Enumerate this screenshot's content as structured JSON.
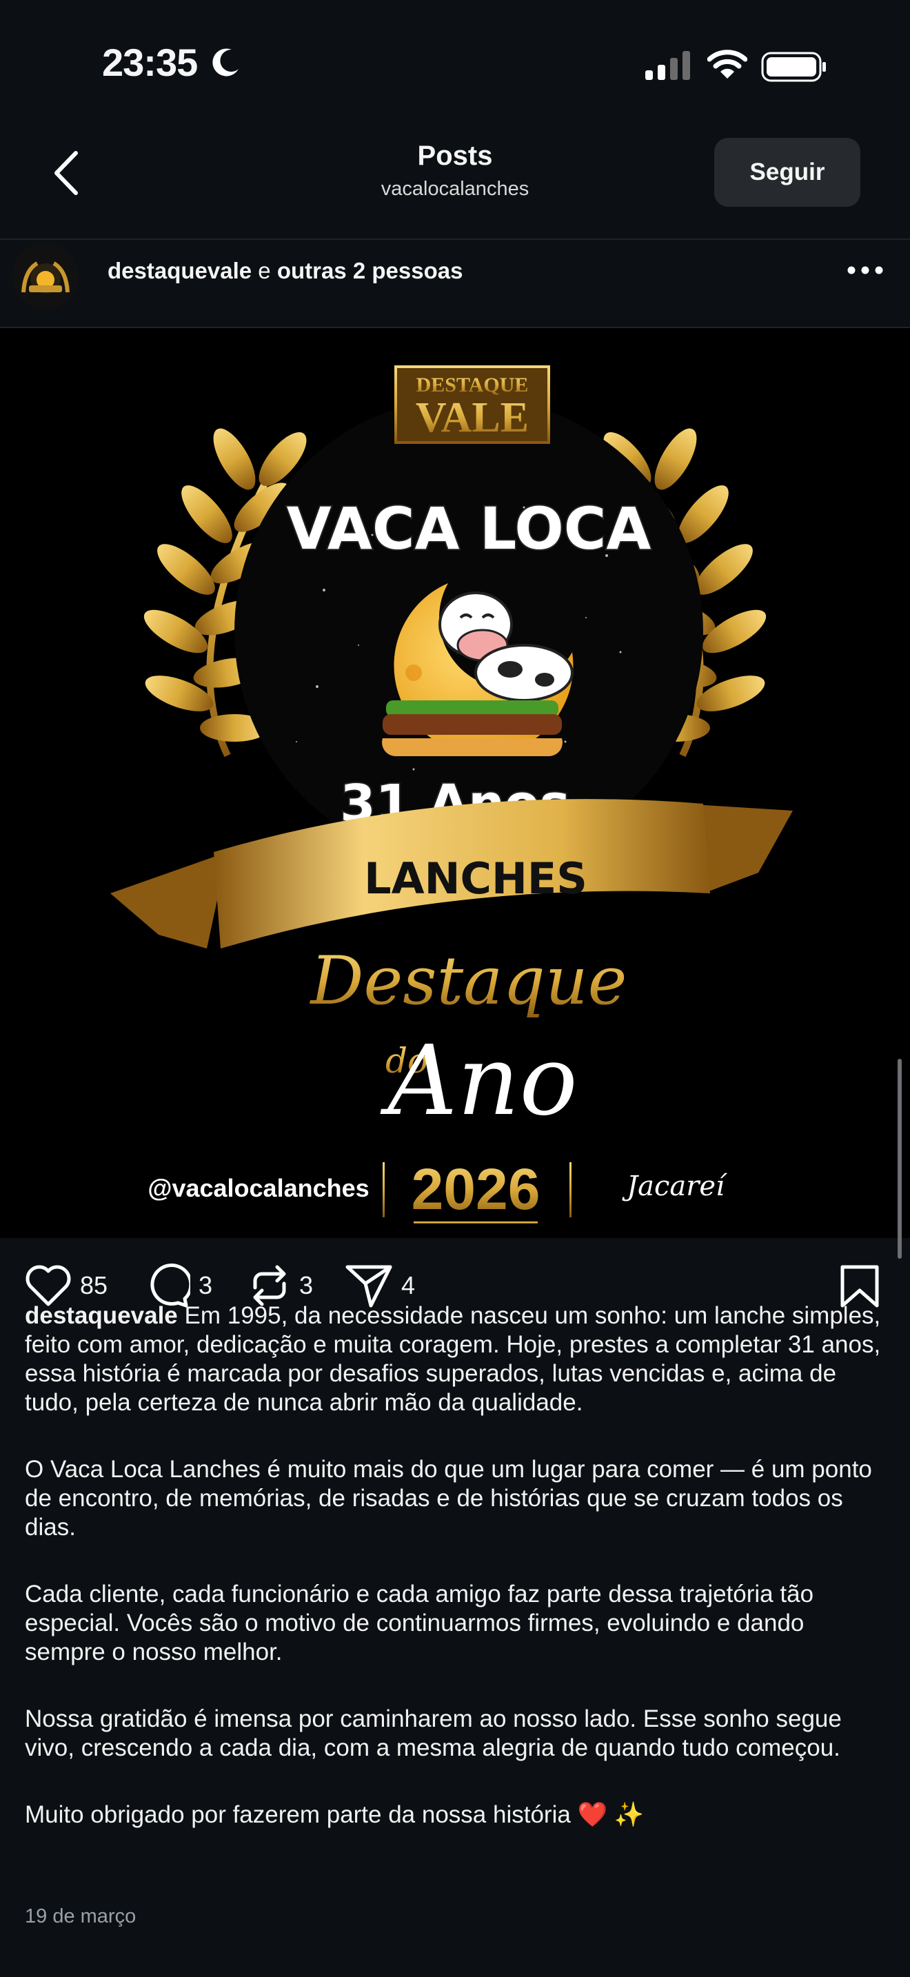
{
  "status_bar": {
    "time": "23:35",
    "moon_icon": "moon-icon",
    "signal_icon": "cellular-signal-icon",
    "wifi_icon": "wifi-icon",
    "battery_icon": "battery-icon"
  },
  "header": {
    "back_icon": "chevron-left-icon",
    "title": "Posts",
    "subtitle": "vacalocalanches",
    "follow_label": "Seguir"
  },
  "post": {
    "author": "destaquevale",
    "author_joiner": " e ",
    "coauthors": "outras 2 pessoas",
    "more_icon": "more-horizontal-icon",
    "image": {
      "badge_top": "DESTAQUE",
      "badge_main": "VALE",
      "brand": "VACA LOCA",
      "years": "31 Anos",
      "ribbon": "LANCHES",
      "award_line1": "Destaque",
      "award_do": "do",
      "award_line2": "Ano",
      "handle": "@vacalocalanches",
      "year": "2026",
      "city": "Jacareí"
    },
    "actions": {
      "likes": "85",
      "comments": "3",
      "reposts": "3",
      "shares": "4",
      "like_icon": "heart-icon",
      "comment_icon": "comment-bubble-icon",
      "repost_icon": "repost-icon",
      "share_icon": "send-icon",
      "save_icon": "bookmark-icon"
    },
    "caption": {
      "username": "destaquevale",
      "p1": "Em 1995, da necessidade nasceu um sonho: um lanche simples, feito com amor, dedicação e muita coragem. Hoje, prestes a completar 31 anos, essa história é marcada por desafios superados, lutas vencidas e, acima de tudo, pela certeza de nunca abrir mão da qualidade.",
      "p2": "O Vaca Loca Lanches é muito mais do que um lugar para comer — é um ponto de encontro, de memórias, de risadas e de histórias que se cruzam todos os dias.",
      "p3": "Cada cliente, cada funcionário e cada amigo faz parte dessa trajetória tão especial. Vocês são o motivo de continuarmos firmes, evoluindo e dando sempre o nosso melhor.",
      "p4": "Nossa gratidão é imensa por caminharem ao nosso lado. Esse sonho segue vivo, crescendo a cada dia, com a mesma alegria de quando tudo começou.",
      "p5": "Muito obrigado por fazerem parte da nossa história ❤️ ✨"
    },
    "date": "19 de março"
  },
  "colors": {
    "background": "#0c1014",
    "button": "#262a2e",
    "gold": "#d9a93a",
    "muted": "#9aa0a6"
  }
}
